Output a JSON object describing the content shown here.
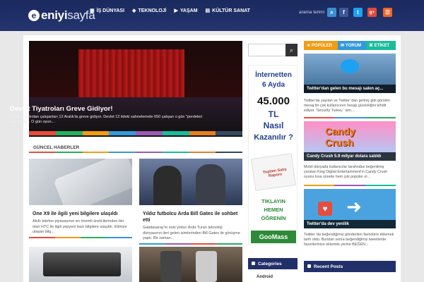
{
  "header": {
    "logo_prefix": "eniyi",
    "logo_suffix": "sayfa",
    "nav": [
      {
        "icon": "grid-icon",
        "label": "İŞ DÜNYASI"
      },
      {
        "icon": "chip-icon",
        "label": "TEKNOLOJİ"
      },
      {
        "icon": "play-icon",
        "label": "YAŞAM"
      },
      {
        "icon": "film-icon",
        "label": "KÜLTÜR SANAT"
      }
    ],
    "search_label": "arama terimi",
    "social": [
      {
        "name": "search-icon",
        "glyph": "⌕",
        "color": "#3a8fd1"
      },
      {
        "name": "facebook-icon",
        "glyph": "f",
        "color": "#3b5998"
      },
      {
        "name": "twitter-icon",
        "glyph": "t",
        "color": "#1da1f2"
      },
      {
        "name": "googleplus-icon",
        "glyph": "g+",
        "color": "#dd4b39"
      },
      {
        "name": "rss-icon",
        "glyph": "☰",
        "color": "#f26522"
      }
    ]
  },
  "slider": {
    "title": "Devlet Tiyatroları Greve Gidiyor!",
    "text": "Devlet Tiyatroları çalışanları 12 Aralık'ta greve gidiyor. Devlet 12 ildeki sahnelerinde 650 çalışan o gün \"perdeleri kapatacak\". O gün oyun...",
    "colors": [
      "#e74c3c",
      "#27ae60",
      "#f39c12",
      "#3498db",
      "#9b59b6",
      "#1abc9c",
      "#e67e22",
      "#34495e"
    ]
  },
  "section": {
    "title": "GÜNCEL HABERLER"
  },
  "cards": [
    {
      "title": "One X9 ile ilgili yeni bilgilere ulaşıldı",
      "text": "Akıllı telefon piyasasının en önemli üreticilerinden biri olan HTC ile ilgili yepyeni bazı bilgilere ulaşıldı. Elimize ulaşan bilg..."
    },
    {
      "title": "Yıldız futbolcu Arda Bill Gates ile sohbet etti",
      "text": "Galatasaray'ın eski yıldızı Arda Turan teknoloji dünyasının ileri gelen isimlerinden Bill Gates ile görüşme yaptı. Bir zaman..."
    }
  ],
  "ad": {
    "line1": "İnternetten",
    "line2": "6 Ayda",
    "line3": "45.000",
    "line4": "TL",
    "line5": "Nasıl",
    "line6": "Kazanılır ?",
    "report": "Toplam Satış Raporu",
    "click1": "TIKLAYIN",
    "click2": "HEMEN",
    "click3": "ÖĞRENİN",
    "button": "GooMass"
  },
  "categories": {
    "title": "Categories",
    "first": "Android"
  },
  "tabs": [
    {
      "label": "POPÜLER",
      "color": "#f39c12"
    },
    {
      "label": "YORUM",
      "color": "#3498db"
    },
    {
      "label": "ETİKET",
      "color": "#1abc9c"
    }
  ],
  "right_posts": [
    {
      "caption": "Twitter'dan gelen bu mesajı sakın aç...",
      "text": "Twitter'da yayılan ve Twitter 'dan gelmiş gibi görülen mesaj bir çok kullanıcının hesap güvenliğini tehdit ediyor. 'Security Turkey ' ism..."
    },
    {
      "caption": "Candy Crush 5.9 milyar dolara satıldı",
      "text": "Mobil dünyada kullanıcılar tarafından beğenilmiş yaratan King Digital Entertainment'ın Candy Crush oyunu kısa sürede hem çok popüler ol..."
    },
    {
      "caption": "Twitter'da dev yenilik",
      "text": "Twitter 'da beğendiğimiz gönderilen favorilere eklemek tarih oldu. Bundan sonra beğendiğimiz tweetlerde favorilerinize eklemek yerine BEĞEN..."
    }
  ],
  "recent": {
    "title": "Recent Posts"
  }
}
